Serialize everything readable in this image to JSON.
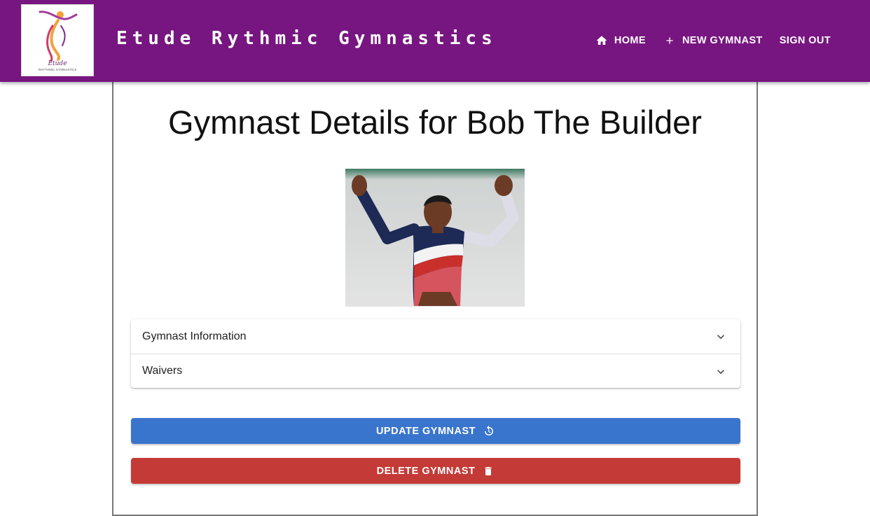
{
  "header": {
    "brand_title": "Etude Rythmic Gymnastics",
    "logo_text": "Etude",
    "logo_subtext": "RHYTHMIC GYMNASTICS",
    "nav": [
      {
        "label": "HOME",
        "icon": "home-icon"
      },
      {
        "label": "NEW GYMNAST",
        "icon": "plus-icon"
      },
      {
        "label": "SIGN OUT",
        "icon": ""
      }
    ],
    "color": "#771680"
  },
  "main": {
    "title": "Gymnast Details for Bob The Builder",
    "accordion": [
      {
        "label": "Gymnast Information",
        "icon": "chevron-down-icon"
      },
      {
        "label": "Waivers",
        "icon": "chevron-down-icon"
      }
    ],
    "update_label": "UPDATE GYMNAST",
    "update_icon": "refresh-icon",
    "update_color": "#3a75cd",
    "delete_label": "DELETE GYMNAST",
    "delete_icon": "trash-icon",
    "delete_color": "#c43a36"
  }
}
